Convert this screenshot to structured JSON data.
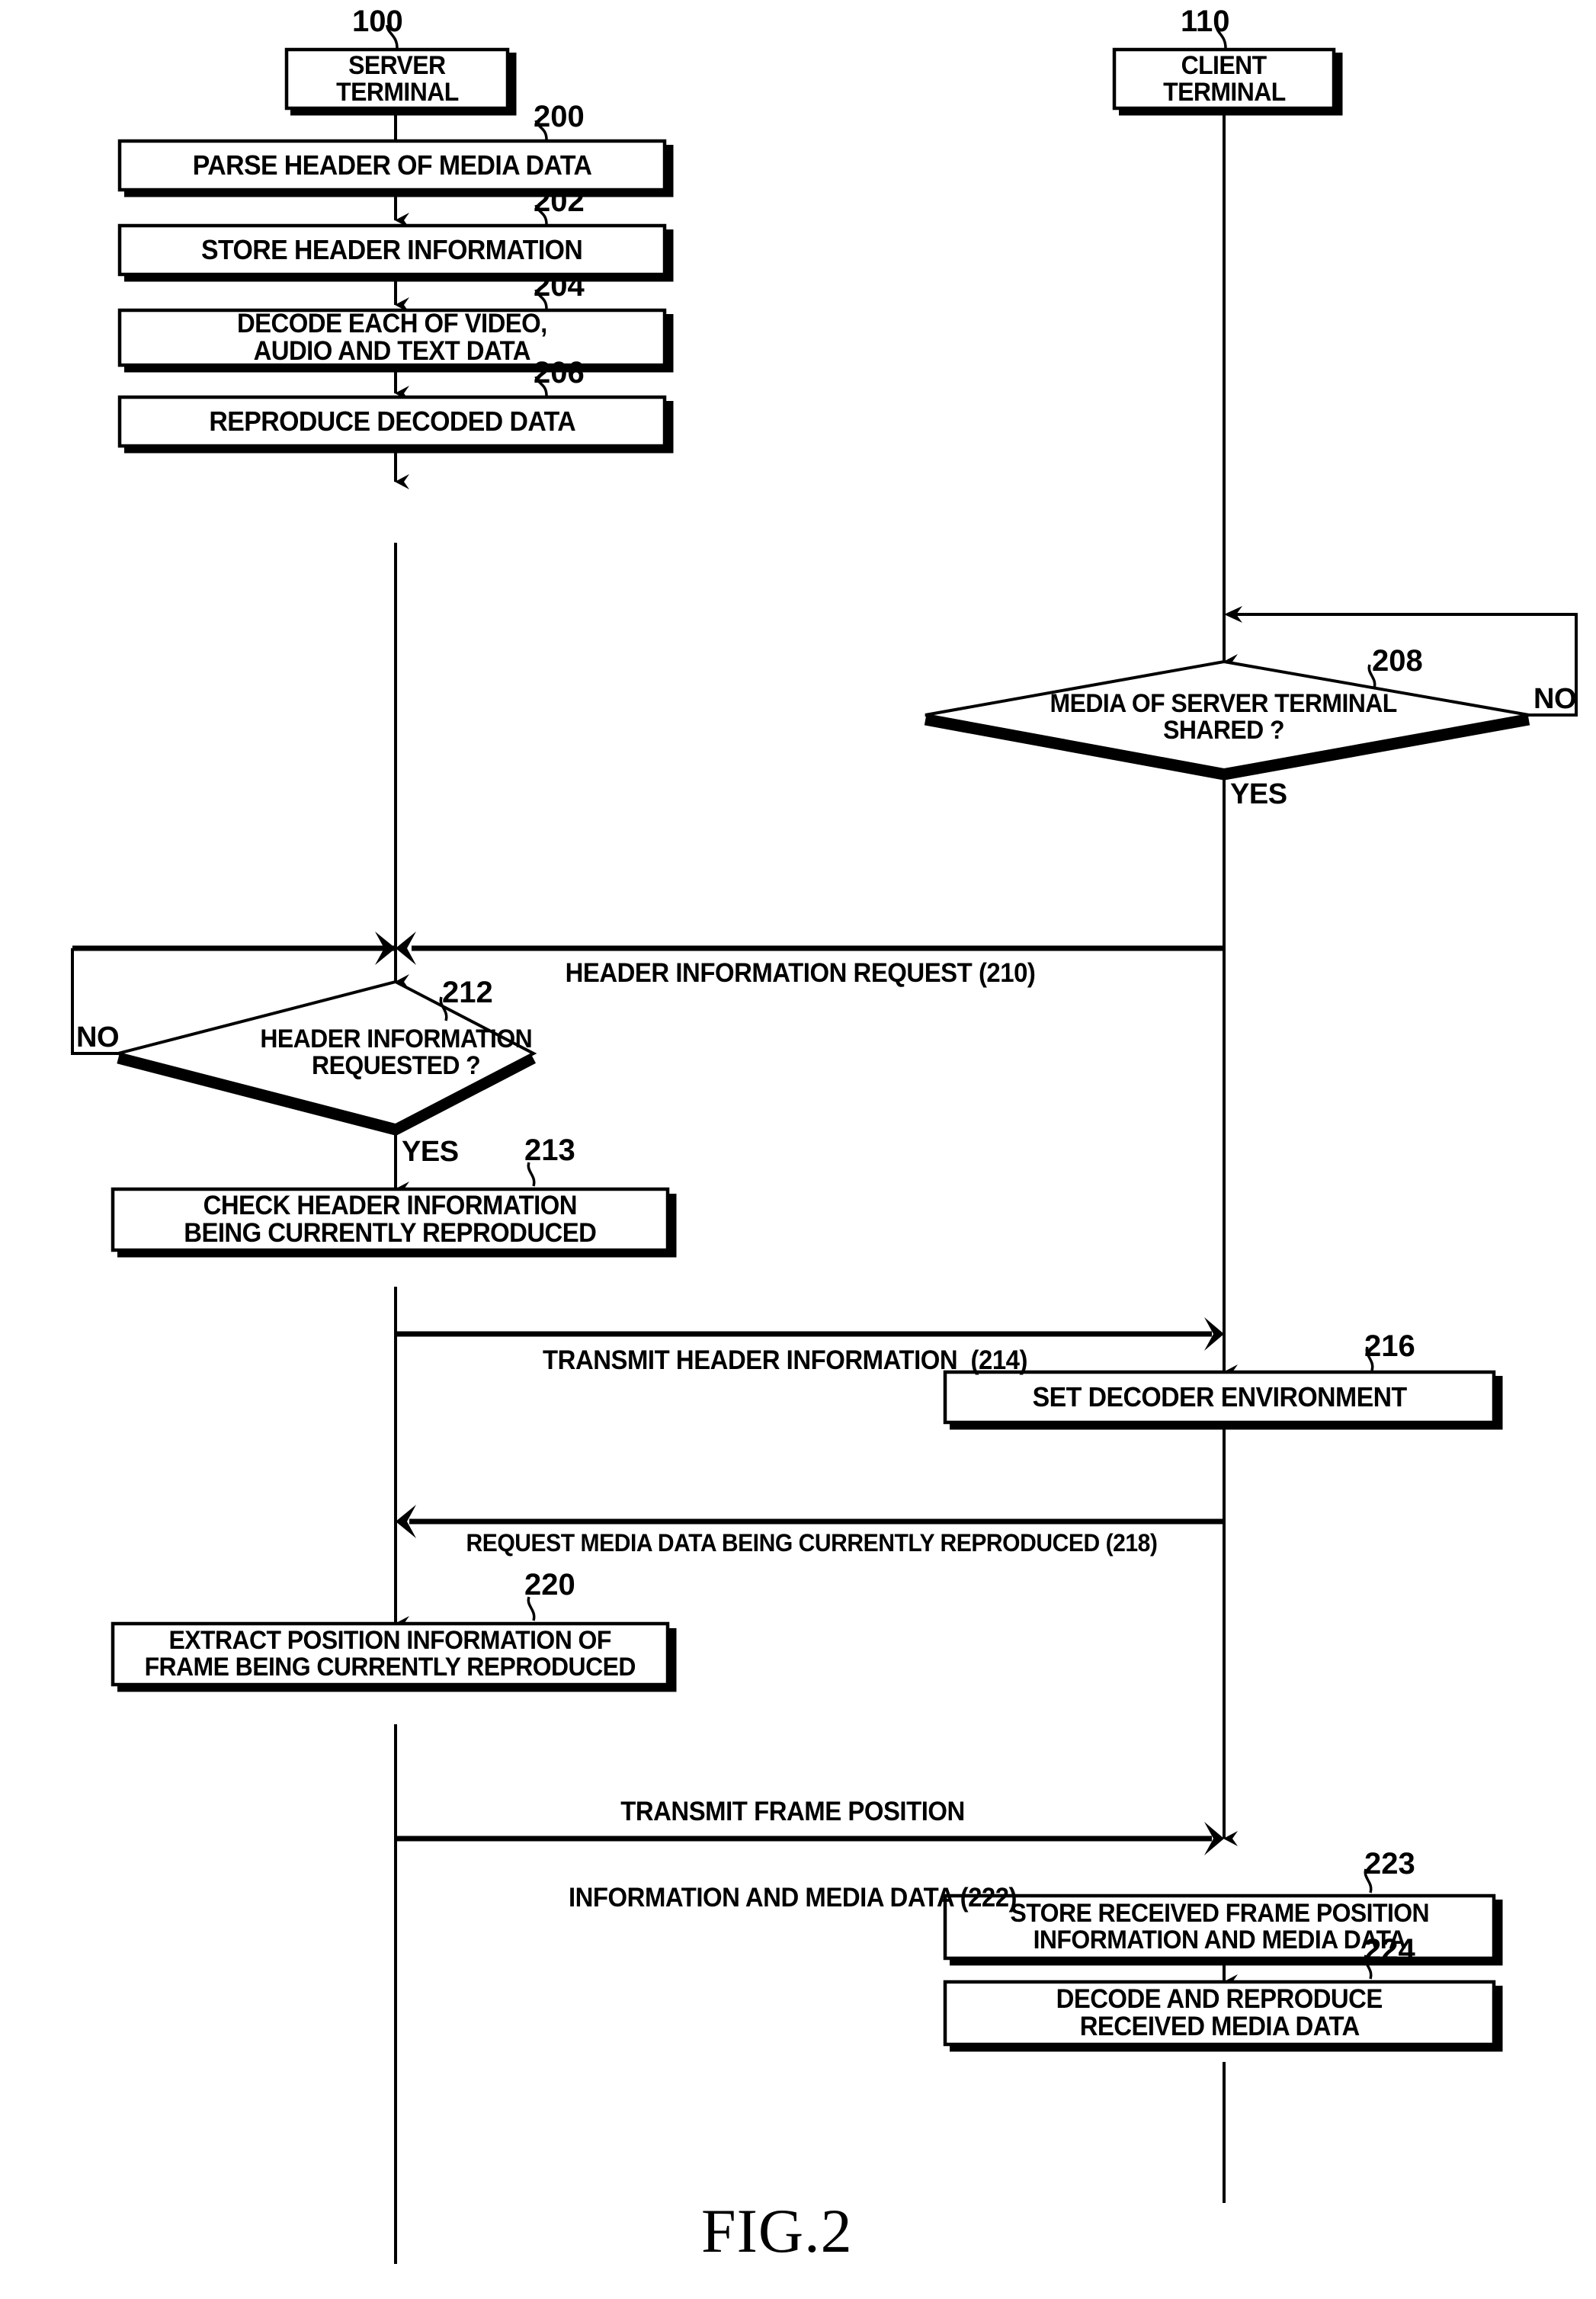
{
  "figure": {
    "caption": "FIG.2"
  },
  "lanes": [
    {
      "id": "server",
      "ref": "100",
      "title_line1": "SERVER",
      "title_line2": "TERMINAL"
    },
    {
      "id": "client",
      "ref": "110",
      "title_line1": "CLIENT",
      "title_line2": "TERMINAL"
    }
  ],
  "server_steps": [
    {
      "ref": "200",
      "lines": [
        "PARSE HEADER OF MEDIA DATA"
      ]
    },
    {
      "ref": "202",
      "lines": [
        "STORE HEADER INFORMATION"
      ]
    },
    {
      "ref": "204",
      "lines": [
        "DECODE EACH OF VIDEO,",
        "AUDIO AND TEXT DATA"
      ]
    },
    {
      "ref": "206",
      "lines": [
        "REPRODUCE DECODED DATA"
      ]
    },
    {
      "ref": "213",
      "lines": [
        "CHECK HEADER INFORMATION",
        "BEING CURRENTLY REPRODUCED"
      ]
    },
    {
      "ref": "220",
      "lines": [
        "EXTRACT POSITION INFORMATION OF",
        "FRAME BEING CURRENTLY REPRODUCED"
      ]
    }
  ],
  "client_steps": [
    {
      "ref": "216",
      "lines": [
        "SET DECODER ENVIRONMENT"
      ]
    },
    {
      "ref": "223",
      "lines": [
        "STORE RECEIVED FRAME POSITION",
        "INFORMATION AND MEDIA DATA"
      ]
    },
    {
      "ref": "224",
      "lines": [
        "DECODE AND REPRODUCE",
        "RECEIVED MEDIA DATA"
      ]
    }
  ],
  "decisions": [
    {
      "ref": "208",
      "lane": "client",
      "lines": [
        "MEDIA OF SERVER TERMINAL",
        "SHARED ?"
      ],
      "yes_label": "YES",
      "no_label": "NO"
    },
    {
      "ref": "212",
      "lane": "server",
      "lines": [
        "HEADER INFORMATION",
        "REQUESTED ?"
      ],
      "yes_label": "YES",
      "no_label": "NO"
    }
  ],
  "messages": [
    {
      "ref": "210",
      "text": "HEADER INFORMATION REQUEST (210)",
      "direction": "client-to-server",
      "lines": [
        "HEADER INFORMATION REQUEST (210)"
      ]
    },
    {
      "ref": "214",
      "text": "TRANSMIT HEADER INFORMATION  (214)",
      "direction": "server-to-client",
      "lines": [
        "TRANSMIT HEADER INFORMATION  (214)"
      ]
    },
    {
      "ref": "218",
      "text": "REQUEST MEDIA DATA BEING CURRENTLY REPRODUCED (218)",
      "direction": "client-to-server",
      "lines": [
        "REQUEST MEDIA DATA BEING CURRENTLY REPRODUCED (218)"
      ]
    },
    {
      "ref": "222",
      "text": "TRANSMIT FRAME POSITION INFORMATION AND MEDIA DATA (222)",
      "direction": "server-to-client",
      "lines": [
        "TRANSMIT FRAME POSITION",
        "INFORMATION AND MEDIA DATA (222)"
      ]
    }
  ],
  "colors": {
    "stroke": "#000000",
    "background": "#ffffff"
  }
}
